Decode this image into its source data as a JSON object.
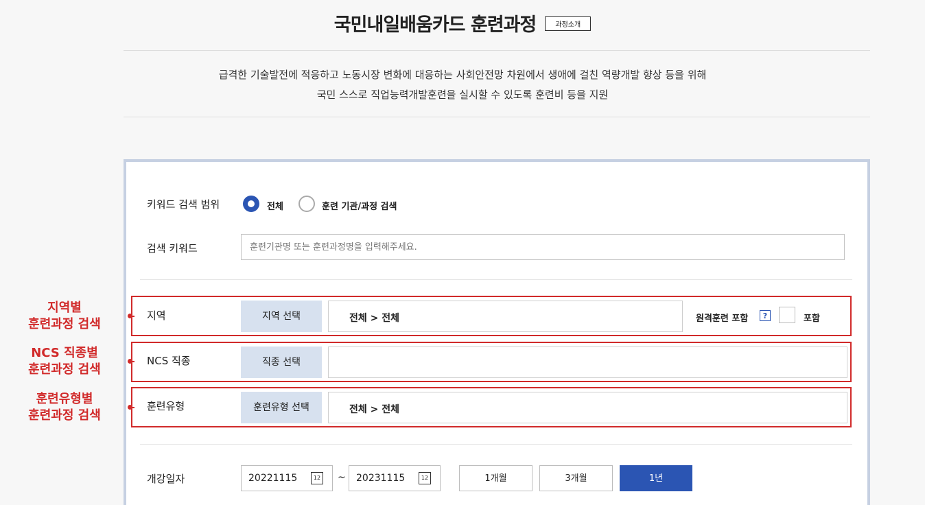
{
  "header": {
    "title": "국민내일배움카드 훈련과정",
    "badge": "과정소개",
    "desc_line1": "급격한 기술발전에 적응하고 노동시장 변화에 대응하는 사회안전망 차원에서 생애에 걸친 역량개발 향상 등을 위해",
    "desc_line2": "국민 스스로 직업능력개발훈련을 실시할 수 있도록 훈련비 등을 지원"
  },
  "search": {
    "scope_label": "키워드 검색 범위",
    "scope_options": [
      "전체",
      "훈련 기관/과정 검색"
    ],
    "scope_selected": "전체",
    "keyword_label": "검색 키워드",
    "keyword_placeholder": "훈련기관명 또는 훈련과정명을 입력해주세요.",
    "region": {
      "label": "지역",
      "button": "지역 선택",
      "value": "전체 > 전체",
      "remote_label": "원격훈련 포함",
      "help": "?",
      "include_label": "포함"
    },
    "ncs": {
      "label": "NCS 직종",
      "button": "직종 선택",
      "value": ""
    },
    "type": {
      "label": "훈련유형",
      "button": "훈련유형 선택",
      "value": "전체 > 전체"
    },
    "date": {
      "label": "개강일자",
      "from": "20221115",
      "to": "20231115",
      "separator": "~",
      "calendar_glyph": "12",
      "periods": [
        "1개월",
        "3개월",
        "1년"
      ],
      "active_period": "1년"
    }
  },
  "annotations": {
    "region": [
      "지역별",
      "훈련과정 검색"
    ],
    "ncs": [
      "NCS 직종별",
      "훈련과정 검색"
    ],
    "type": [
      "훈련유형별",
      "훈련과정 검색"
    ]
  },
  "colors": {
    "accent": "#2b55b3",
    "annotation": "#d12a2a",
    "select_button": "#d7e1ef",
    "panel_border": "#c6d0e2"
  }
}
